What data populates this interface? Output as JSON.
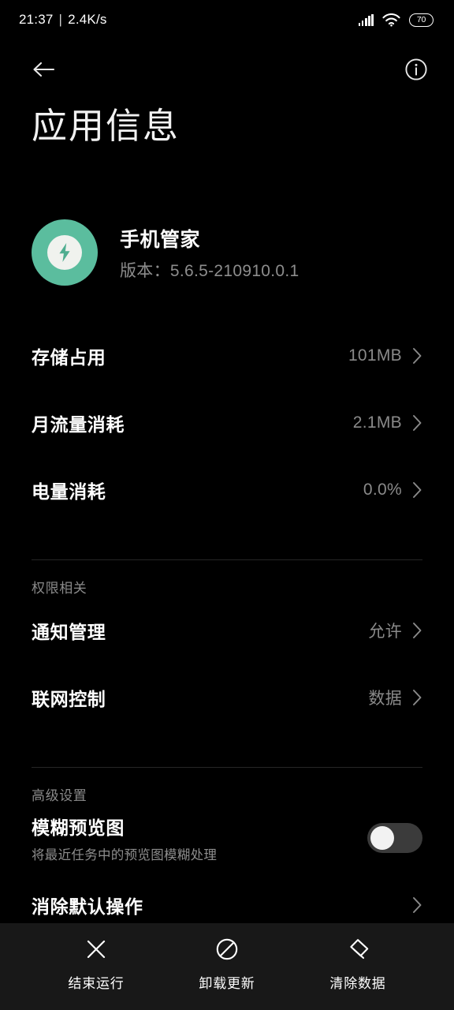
{
  "status_bar": {
    "time": "21:37",
    "separator": "|",
    "network_speed": "2.4K/s",
    "signal_icon": "signal-bars-icon",
    "wifi_icon": "wifi-icon",
    "battery_level": "70"
  },
  "top_nav": {
    "back_icon": "back-arrow-icon",
    "info_icon": "info-circle-icon"
  },
  "page": {
    "title": "应用信息"
  },
  "app": {
    "icon": "lightning-bolt-icon",
    "icon_bg_color": "#5bbd9e",
    "name": "手机管家",
    "version": "版本：5.6.5-210910.0.1"
  },
  "usage_rows": [
    {
      "title": "存储占用",
      "value": "101MB",
      "chevron": "chevron-right-icon"
    },
    {
      "title": "月流量消耗",
      "value": "2.1MB",
      "chevron": "chevron-right-icon"
    },
    {
      "title": "电量消耗",
      "value": "0.0%",
      "chevron": "chevron-right-icon"
    }
  ],
  "permission_section": {
    "label": "权限相关",
    "rows": [
      {
        "title": "通知管理",
        "value": "允许",
        "chevron": "chevron-right-icon"
      },
      {
        "title": "联网控制",
        "value": "数据",
        "chevron": "chevron-right-icon"
      }
    ]
  },
  "advanced_section": {
    "label": "高级设置",
    "blur_preview": {
      "title": "模糊预览图",
      "subtitle": "将最近任务中的预览图模糊处理",
      "toggle_state": "off"
    },
    "clear_defaults": {
      "title": "消除默认操作",
      "chevron": "chevron-right-icon"
    }
  },
  "bottom_bar": {
    "actions": [
      {
        "label": "结束运行",
        "icon": "close-x-icon"
      },
      {
        "label": "卸载更新",
        "icon": "prohibited-circle-icon"
      },
      {
        "label": "清除数据",
        "icon": "eraser-icon"
      }
    ]
  }
}
